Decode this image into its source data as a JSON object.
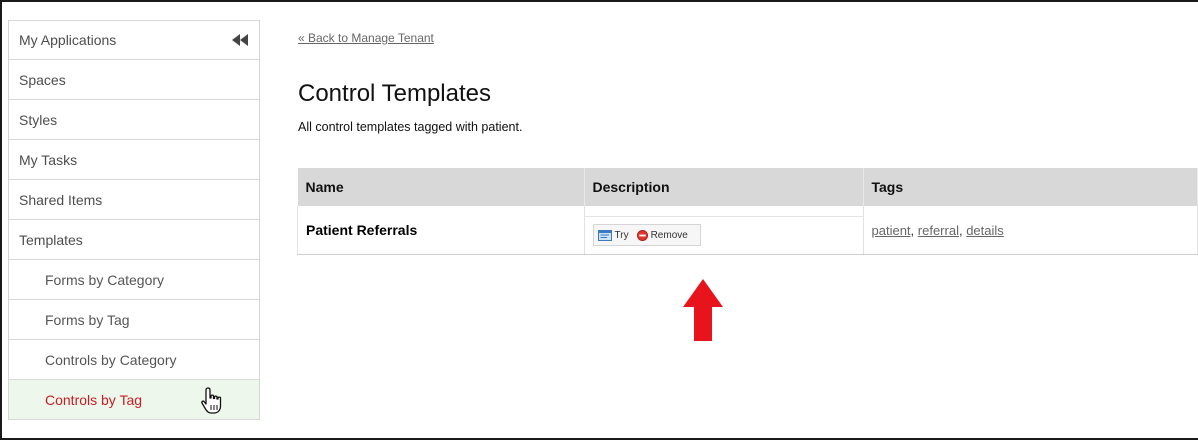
{
  "sidebar": {
    "items": [
      {
        "label": "My Applications"
      },
      {
        "label": "Spaces"
      },
      {
        "label": "Styles"
      },
      {
        "label": "My Tasks"
      },
      {
        "label": "Shared Items"
      },
      {
        "label": "Templates"
      },
      {
        "label": "Forms by Category"
      },
      {
        "label": "Forms by Tag"
      },
      {
        "label": "Controls by Category"
      },
      {
        "label": "Controls by Tag"
      }
    ],
    "active_color": "#c81d25"
  },
  "main": {
    "back_link": "« Back to Manage Tenant",
    "title": "Control Templates",
    "subtitle": "All control templates tagged with patient.",
    "table": {
      "headers": [
        "Name",
        "Description",
        "Tags"
      ],
      "rows": [
        {
          "name": "Patient Referrals",
          "try_label": "Try",
          "remove_label": "Remove",
          "tags": [
            "patient",
            "referral",
            "details"
          ]
        }
      ]
    }
  },
  "annotation": {
    "arrow_color": "#e8141c"
  }
}
